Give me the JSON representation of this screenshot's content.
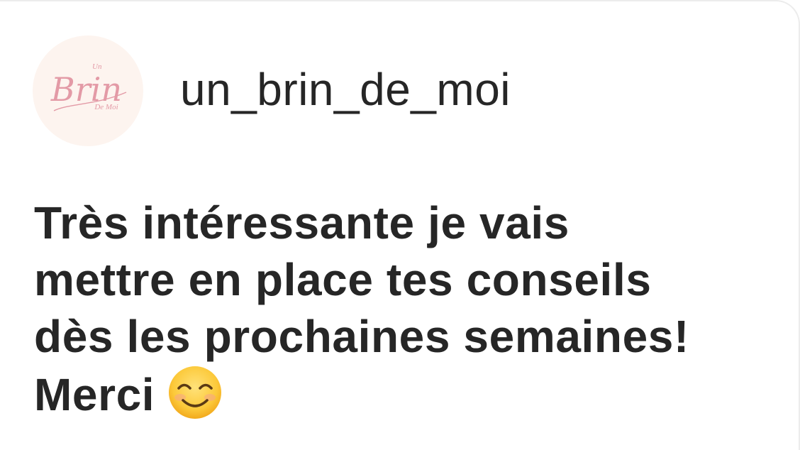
{
  "post": {
    "username": "un_brin_de_moi",
    "avatar": {
      "logo_text_top": "Un",
      "logo_text_main": "Brin",
      "logo_text_bottom": "De Moi",
      "background_color": "#fdf4ef",
      "logo_color": "#e39aa6"
    },
    "comment_lines": [
      "Très intéressante je vais",
      "mettre en place tes conseils",
      "dès les prochaines semaines!",
      "Merci"
    ],
    "emoji": "smiling-face-with-smiling-eyes"
  },
  "colors": {
    "text": "#262626",
    "background": "#ffffff"
  }
}
